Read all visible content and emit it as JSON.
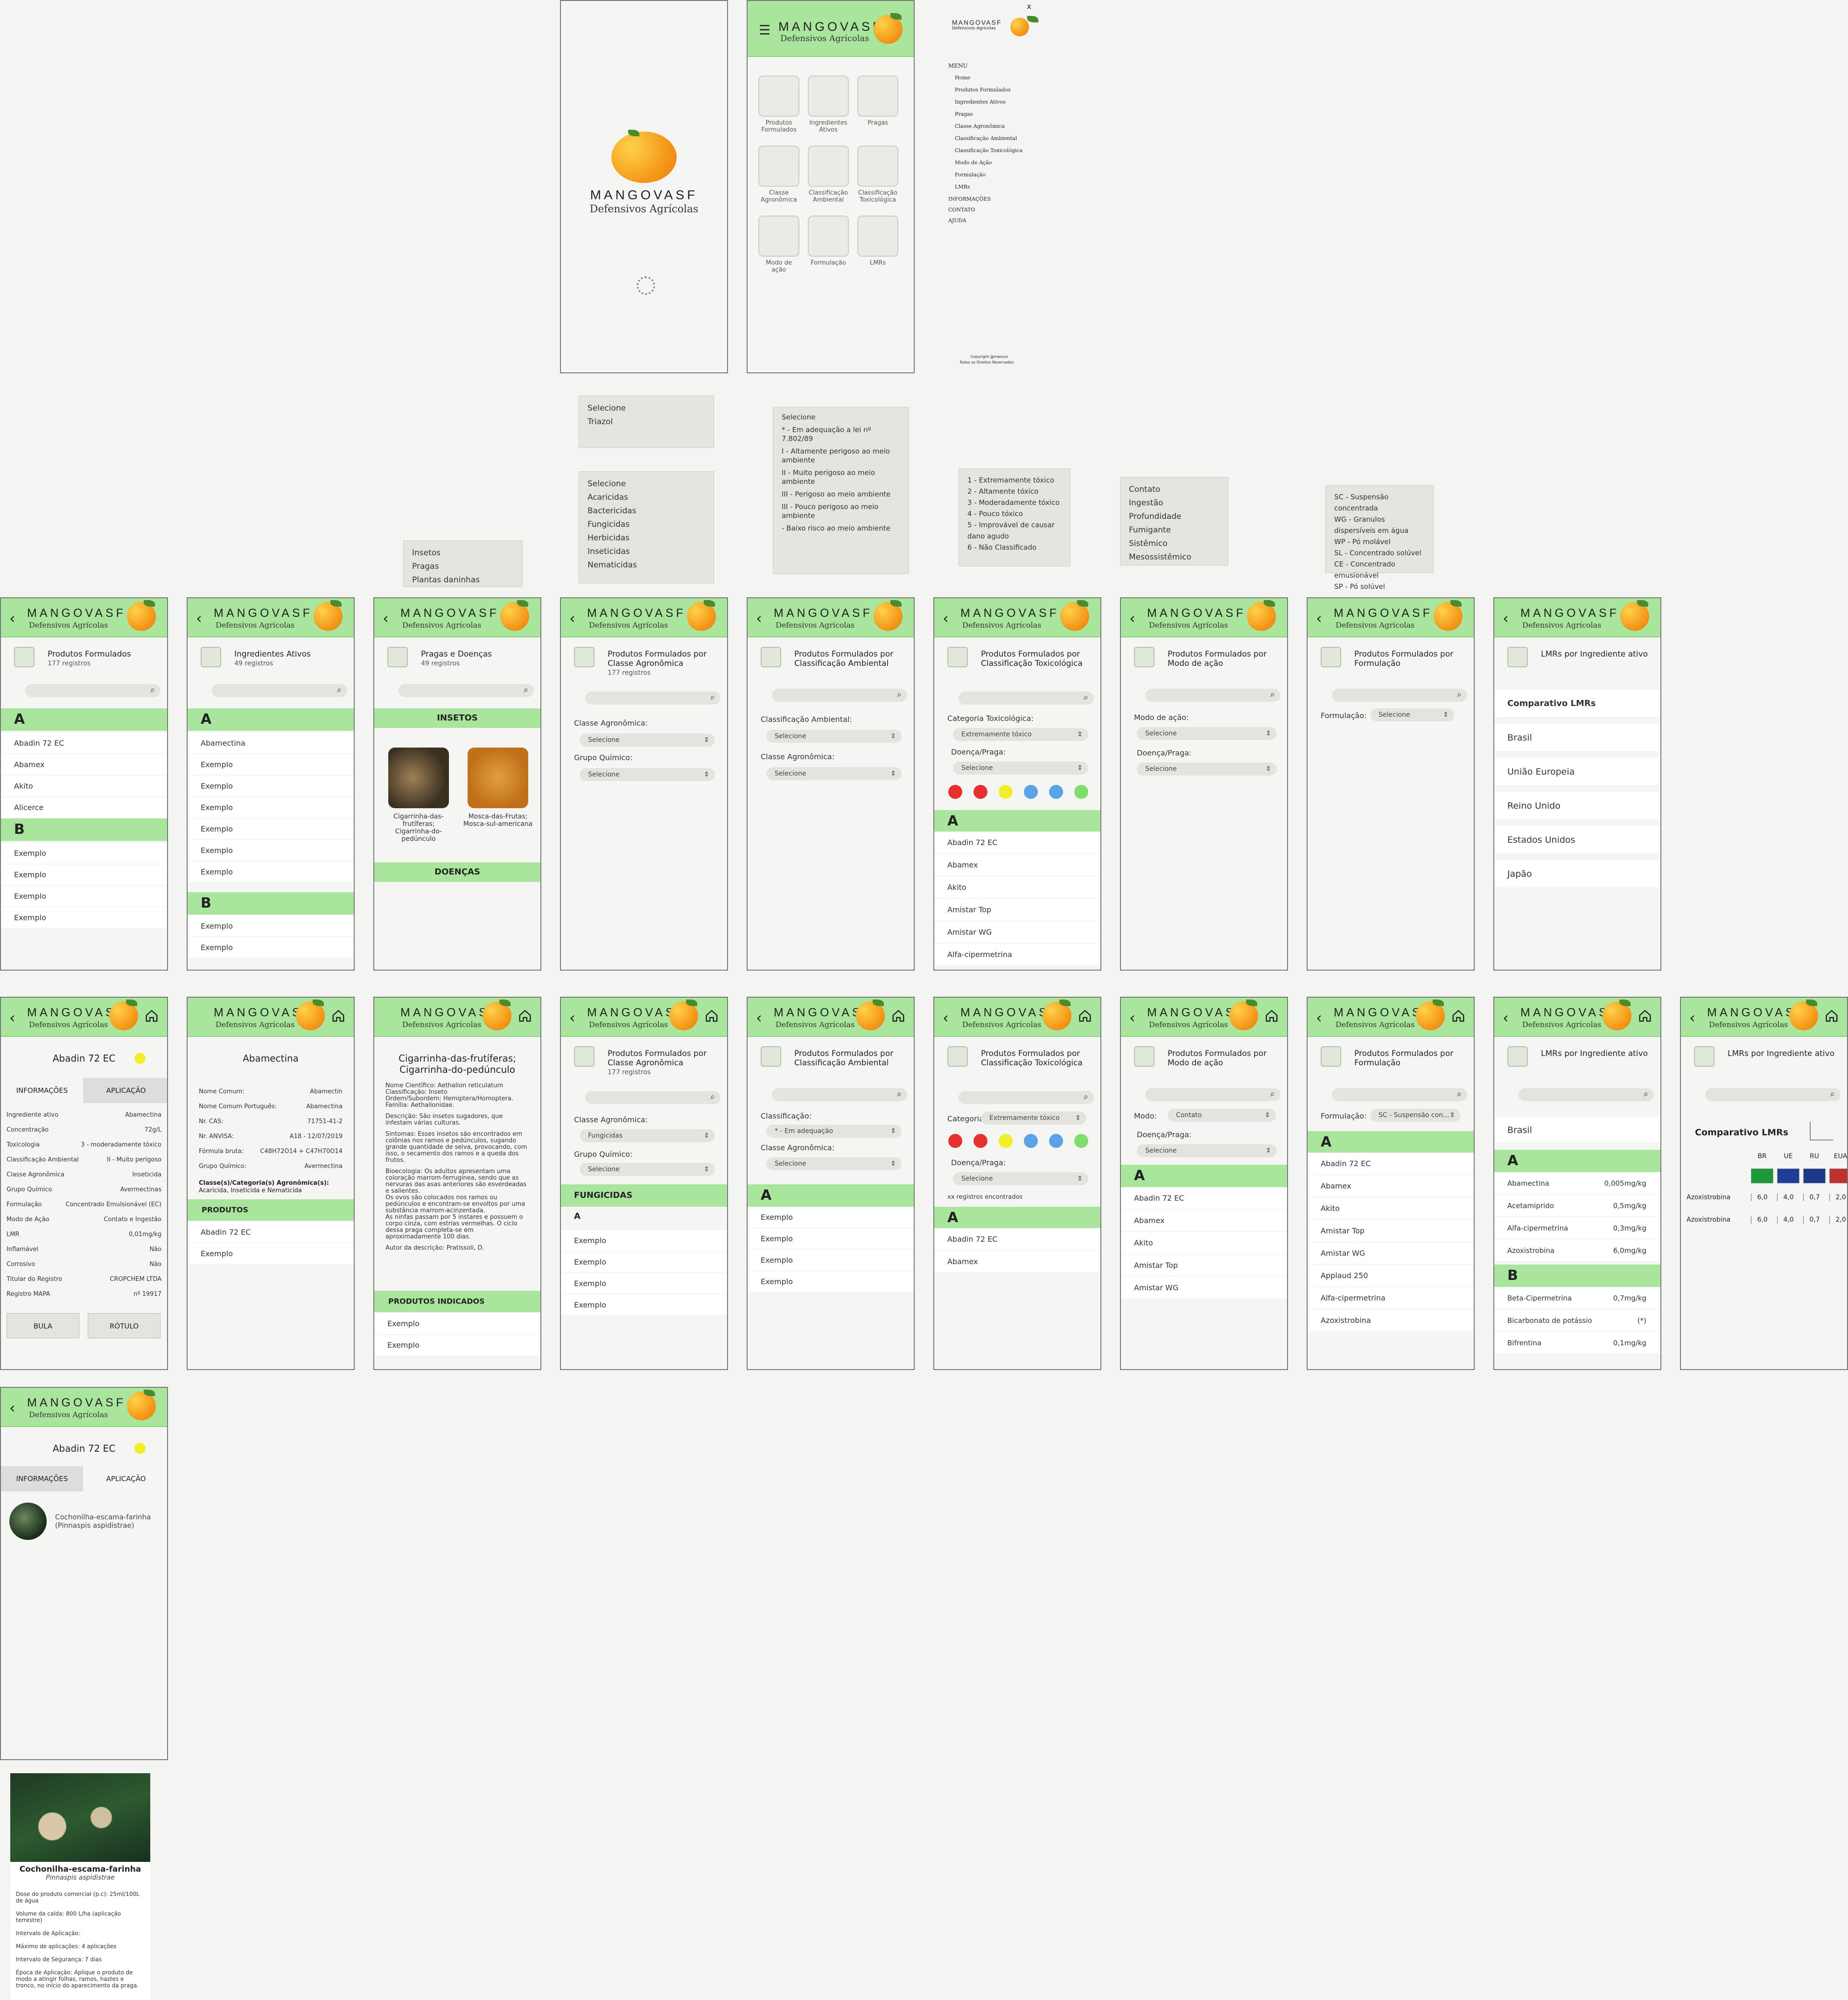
{
  "brand": {
    "name": "MANGOVASF",
    "sub": "Defensivos Agrícolas"
  },
  "splash": {
    "name": "MANGOVASF",
    "sub": "Defensivos Agrícolas"
  },
  "home": {
    "items": [
      "Produtos Formulados",
      "Ingredientes Ativos",
      "Pragas",
      "Classe Agronômica",
      "Classificação Ambiental",
      "Classificação Toxicológica",
      "Modo de ação",
      "Formulação",
      "LMRs"
    ]
  },
  "menu": {
    "title": "MENU",
    "items": [
      "Home",
      "Produtos Formulados",
      "Ingredientes Ativos",
      "Pragas",
      "Classe Agronômica",
      "Classificação Ambiental",
      "Classificação Toxicológica",
      "Modo de Ação",
      "Formulação",
      "LMRs"
    ],
    "sections": [
      "INFORMAÇÕES",
      "CONTATO",
      "AJUDA"
    ],
    "copyright": "Copyright @mansvs",
    "rights": "Todos os Direitos Reservados",
    "close": "x"
  },
  "popups": {
    "classe": [
      "Selecione",
      "Triazol"
    ],
    "grupo": [
      "Selecione",
      "Acaricidas",
      "Bactericidas",
      "Fungicidas",
      "Herbicidas",
      "Inseticidas",
      "Nematicidas"
    ],
    "pragas": [
      "Insetos",
      "Pragas",
      "Plantas daninhas"
    ],
    "ambiental": [
      "Selecione",
      "* - Em adequação a lei nº 7.802/89",
      "I - Altamente perigoso ao meio ambiente",
      "II - Muito perigoso ao meio ambiente",
      "III - Perigoso ao meio ambiente",
      "III - Pouco perigoso ao meio ambiente",
      "- Baixo risco ao meio ambiente"
    ],
    "tox": [
      "1 - Extremamente tóxico",
      "2 - Altamente tóxico",
      "3 - Moderadamente tóxico",
      "4 - Pouco tóxico",
      "5 - Improvável de causar dano agudo",
      "6 - Não Classificado"
    ],
    "modo": [
      "Contato",
      "Ingestão",
      "Profundidade",
      "Fumigante",
      "Sistêmico",
      "Mesossistêmico"
    ],
    "form": [
      "SC - Suspensão concentrada",
      "WG - Granulos dispersíveis em água",
      "WP - Pó molável",
      "SL - Concentrado solúvel",
      "CE - Concentrado emusionável",
      "SP - Pó solúvel"
    ]
  },
  "row1": {
    "pf": {
      "title": "Produtos Formulados",
      "count": "177 registros",
      "secA": "A",
      "secB": "B",
      "a": [
        "Abadin 72 EC",
        "Abamex",
        "Akito",
        "Alicerce"
      ],
      "b": [
        "Exemplo",
        "Exemplo",
        "Exemplo",
        "Exemplo"
      ]
    },
    "ia": {
      "title": "Ingredientes Ativos",
      "count": "49 registros",
      "secA": "A",
      "secB": "B",
      "a": [
        "Abamectina",
        "Exemplo",
        "Exemplo",
        "Exemplo",
        "Exemplo",
        "Exemplo",
        "Exemplo"
      ],
      "b": [
        "Exemplo",
        "Exemplo"
      ]
    },
    "pd": {
      "title": "Pragas e Doenças",
      "count": "49 registros",
      "ins": "INSETOS",
      "doe": "DOENÇAS",
      "c1": "Cigarrinha-das-frutíferas; Cigarrinha-do-pedúnculo",
      "c2": "Mosca-das-Frutas; Mosca-sul-americana"
    },
    "ca": {
      "title": "Produtos Formulados por Classe Agronômica",
      "count": "177 registros",
      "l1": "Classe Agronômica:",
      "l2": "Grupo Químico:",
      "s": "Selecione"
    },
    "amb": {
      "title": "Produtos Formulados por Classificação Ambiental",
      "l1": "Classificação Ambiental:",
      "l2": "Classe Agronômica:",
      "s": "Selecione"
    },
    "tox": {
      "title": "Produtos Formulados por Classificação Toxicológica",
      "l1": "Categoria Toxicológica:",
      "v1": "Extremamente tóxico",
      "l2": "Doença/Praga:",
      "s": "Selecione",
      "sec": "A",
      "rows": [
        "Abadin 72 EC",
        "Abamex",
        "Akito",
        "Amistar Top",
        "Amistar WG",
        "Alfa-cipermetrina"
      ]
    },
    "modo": {
      "title": "Produtos Formulados por Modo de ação",
      "l1": "Modo de ação:",
      "l2": "Doença/Praga:",
      "s": "Selecione"
    },
    "form": {
      "title": "Produtos Formulados por Formulação",
      "l1": "Formulação:",
      "s": "Selecione"
    },
    "lmr": {
      "title": "LMRs por Ingrediente ativo",
      "rows": [
        "Comparativo LMRs",
        "Brasil",
        "União Europeia",
        "Reino Unido",
        "Estados Unidos",
        "Japão"
      ]
    }
  },
  "row2": {
    "det": {
      "name": "Abadin 72 EC",
      "t1": "INFORMAÇÕES",
      "t2": "APLICAÇÃO",
      "kv": [
        [
          "Ingrediente ativo",
          "Abamectina"
        ],
        [
          "Concentração",
          "72g/L"
        ],
        [
          "Toxicologia",
          "3 - moderadamente tóxico"
        ],
        [
          "Classificação Ambiental",
          "II - Muito perigoso"
        ],
        [
          "Classe Agronômica",
          "Inseticida"
        ],
        [
          "Grupo Químico",
          "Avermectinas"
        ],
        [
          "Formulação",
          "Concentrado Emulsionável (EC)"
        ],
        [
          "Modo de Ação",
          "Contato e Ingestão"
        ],
        [
          "LMR",
          "0,01mg/kg"
        ],
        [
          "Inflamável",
          "Não"
        ],
        [
          "Corrosivo",
          "Não"
        ],
        [
          "Titular do Registro",
          "CROPCHEM LTDA"
        ],
        [
          "Registro MAPA",
          "nº 19917"
        ]
      ],
      "b1": "BULA",
      "b2": "RÓTULO"
    },
    "aba": {
      "name": "Abamectina",
      "kv": [
        [
          "Nome Comum:",
          "Abamectin"
        ],
        [
          "Nome Comum Português:",
          "Abamectina"
        ],
        [
          "Nr. CAS:",
          "71751-41-2"
        ],
        [
          "Nr. ANVISA:",
          "A18 - 12/07/2019"
        ],
        [
          "Fórmula bruta:",
          "C48H72O14 + C47H70O14"
        ],
        [
          "Grupo Químico:",
          "Avermectina"
        ]
      ],
      "cls": "Classe(s)/Categoria(s) Agronômica(s):",
      "clsv": "Acaricida, Inseticida e Nematicida",
      "prod": "PRODUTOS",
      "rows": [
        "Abadin 72 EC",
        "Exemplo"
      ]
    },
    "cig": {
      "name": "Cigarrinha-das-frutíferas; Cigarrinha-do-pedúnculo",
      "text": [
        "Nome Científico: Aethalion reticulatum",
        "Classificação: Inseto",
        "Ordem/Subordem: Hemiptera/Homoptera.",
        "Família: Aethalionidae.",
        "",
        "Descrição: São insetos sugadores, que infestam várias culturas.",
        "",
        "Sintomas: Esses insetos são encontrados em colônias nos ramos e pedúnculos, sugando grande quantidade de seiva, provocando, com isso, o secamento dos ramos e a queda dos frutos.",
        "",
        "Bioecologia: Os adultos apresentam uma coloração marrom-ferruginea, sendo que as nervuras das asas anteriores são esverdeadas e salientes.",
        "Os ovos são colocados nos ramos ou pedúnculos e encontram-se envoltos por uma substância marrom-acinzentada.",
        "As ninfas passam por 5 instares e possuem o corpo cinza, com estrias vermelhas. O ciclo dessa praga completa-se em aproximadamente 100 dias.",
        "",
        "Autor da descrição: Pratissoli, D."
      ],
      "prod": "PRODUTOS INDICADOS",
      "rows": [
        "Exemplo",
        "Exemplo"
      ]
    },
    "ca": {
      "title": "Produtos Formulados por Classe Agronômica",
      "count": "177 registros",
      "l1": "Classe Agronômica:",
      "v1": "Fungicidas",
      "l2": "Grupo Químico:",
      "s": "Selecione",
      "sec": "FUNGICIDAS",
      "a": "A",
      "rows": [
        "Exemplo",
        "Exemplo",
        "Exemplo",
        "Exemplo"
      ]
    },
    "amb": {
      "title": "Produtos Formulados por Classificação Ambiental",
      "l1": "Classificação:",
      "v1": "* - Em adequação",
      "l2": "Classe Agronômica:",
      "s": "Selecione",
      "a": "A",
      "rows": [
        "Exemplo",
        "Exemplo",
        "Exemplo",
        "Exemplo"
      ]
    },
    "tox": {
      "title": "Produtos Formulados por Classificação Toxicológica",
      "l1": "Categoria:",
      "v1": "Extremamente tóxico",
      "l2": "Doença/Praga:",
      "s": "Selecione",
      "found": "xx registros encontrados",
      "a": "A",
      "rows": [
        "Abadin 72 EC",
        "Abamex"
      ]
    },
    "modo": {
      "title": "Produtos Formulados por Modo de ação",
      "l1": "Modo:",
      "v1": "Contato",
      "l2": "Doença/Praga:",
      "s": "Selecione",
      "a": "A",
      "rows": [
        "Abadin 72 EC",
        "Abamex",
        "Akito",
        "Amistar Top",
        "Amistar WG"
      ]
    },
    "form": {
      "title": "Produtos Formulados por Formulação",
      "l1": "Formulação:",
      "v1": "SC - Suspensão con...",
      "a": "A",
      "rows": [
        "Abadin 72 EC",
        "Abamex",
        "Akito",
        "Amistar Top",
        "Amistar WG",
        "Applaud 250",
        "Alfa-cipermetrina",
        "Azoxistrobina"
      ]
    },
    "lmrbr": {
      "title": "LMRs por Ingrediente ativo",
      "country": "Brasil",
      "a": "A",
      "b": "B",
      "ra": [
        [
          "Abamectina",
          "0,005mg/kg"
        ],
        [
          "Acetamiprido",
          "0,5mg/kg"
        ],
        [
          "Alfa-cipermetrina",
          "0,3mg/kg"
        ],
        [
          "Azoxistrobina",
          "6,0mg/kg"
        ]
      ],
      "rb": [
        [
          "Beta-Cipermetrina",
          "0,7mg/kg"
        ],
        [
          "Bicarbonato de potássio",
          "(*)"
        ],
        [
          "Bifrentina",
          "0,1mg/kg"
        ]
      ]
    },
    "lmrcmp": {
      "title": "LMRs por Ingrediente ativo",
      "head": "Comparativo LMRs",
      "cols": [
        "BR",
        "UE",
        "RU",
        "EUA"
      ],
      "rows": [
        [
          "Azoxistrobina",
          "6,0",
          "4,0",
          "0,7",
          "2,0"
        ],
        [
          "Azoxistrobina",
          "6,0",
          "4,0",
          "0,7",
          "2,0"
        ]
      ]
    }
  },
  "row3": {
    "name": "Abadin 72 EC",
    "t1": "INFORMAÇÕES",
    "t2": "APLICAÇÃO",
    "pest": "Cochonilha-escama-farinha",
    "pestsci": "(Pinnaspis aspidistrae)"
  },
  "card": {
    "name": "Cochonilha-escama-farinha",
    "sci": "Pinnaspis aspidistrae",
    "lines": [
      "Dose do produto comercial (p.c): 25ml/100L de água",
      "Volume da calda: 800 L/ha (aplicação terrestre)",
      "Intervalo de Aplicação:",
      "Máximo de aplicações: 4 aplicações",
      "Intervalo de Segurança: 7 dias",
      "Época de Aplicação: Aplique o produto de modo a atingir folhas, ramos, hastes e tronco, no início do aparecimento da praga."
    ]
  },
  "colors": {
    "green": "#a9e59d",
    "red": "#e53030",
    "yellow": "#f2ee2c",
    "blue": "#5aa4e6",
    "lgreen": "#7ee06a"
  }
}
